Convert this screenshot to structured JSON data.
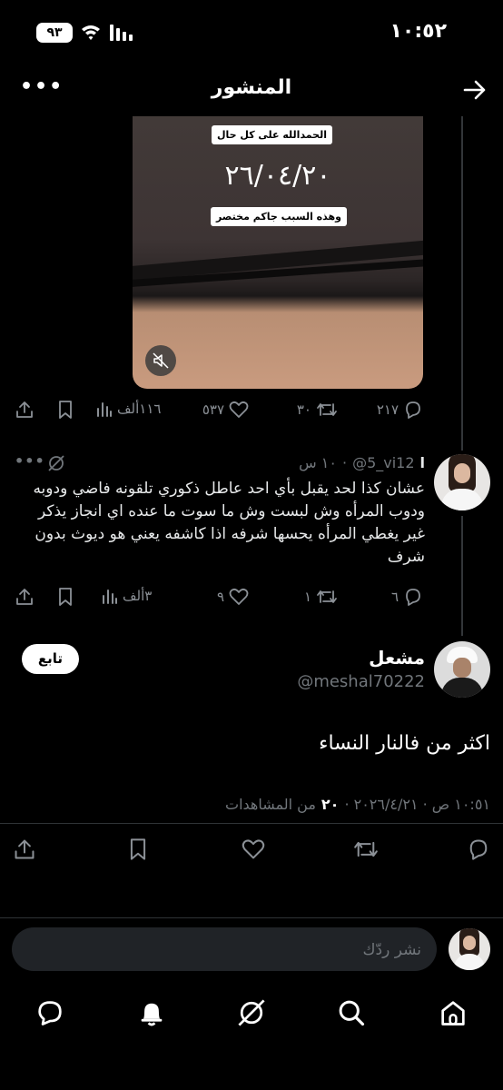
{
  "status_bar": {
    "time": "١٠:٥٢",
    "battery": "٩٣"
  },
  "header": {
    "title": "المنشور"
  },
  "media": {
    "label_top": "الحمدالله على كل حال",
    "date": "٢٦/٠٤/٢٠",
    "label_bottom": "وهذه السبب جاكم مختصر"
  },
  "quoted_actions": {
    "replies": "٢١٧",
    "reposts": "٣٠",
    "likes": "٥٣٧",
    "views": "١١٦ألف"
  },
  "reply": {
    "prefix": "ا",
    "handle": "@5_vi12",
    "time": "١٠ س",
    "text": "عشان كذا لحد يقبل بأي احد عاطل ذكوري تلقونه فاضي ودوبه ودوب المرأه وش لبست وش ما سوت ما عنده اي انجاز يذكر غير يغطي المرأه يحسها شرفه اذا كاشفه يعني هو ديوث بدون شرف",
    "replies": "٦",
    "reposts": "١",
    "likes": "٩",
    "views": "٣ألف"
  },
  "post": {
    "author_name": "مشعل",
    "author_handle": "@meshal70222",
    "follow_label": "تابع",
    "text": "اكثر من فالنار النساء",
    "meta_time": "١٠:٥١ ص · ٢٠٢٦/٤/٢١ ·",
    "meta_views": "٢٠",
    "meta_views_label": "من المشاهدات"
  },
  "reply_bar": {
    "placeholder": "نشر ردّك"
  },
  "colors": {
    "background": "#000000",
    "muted": "#71767b",
    "divider": "#2f3336",
    "input": "#202327"
  }
}
